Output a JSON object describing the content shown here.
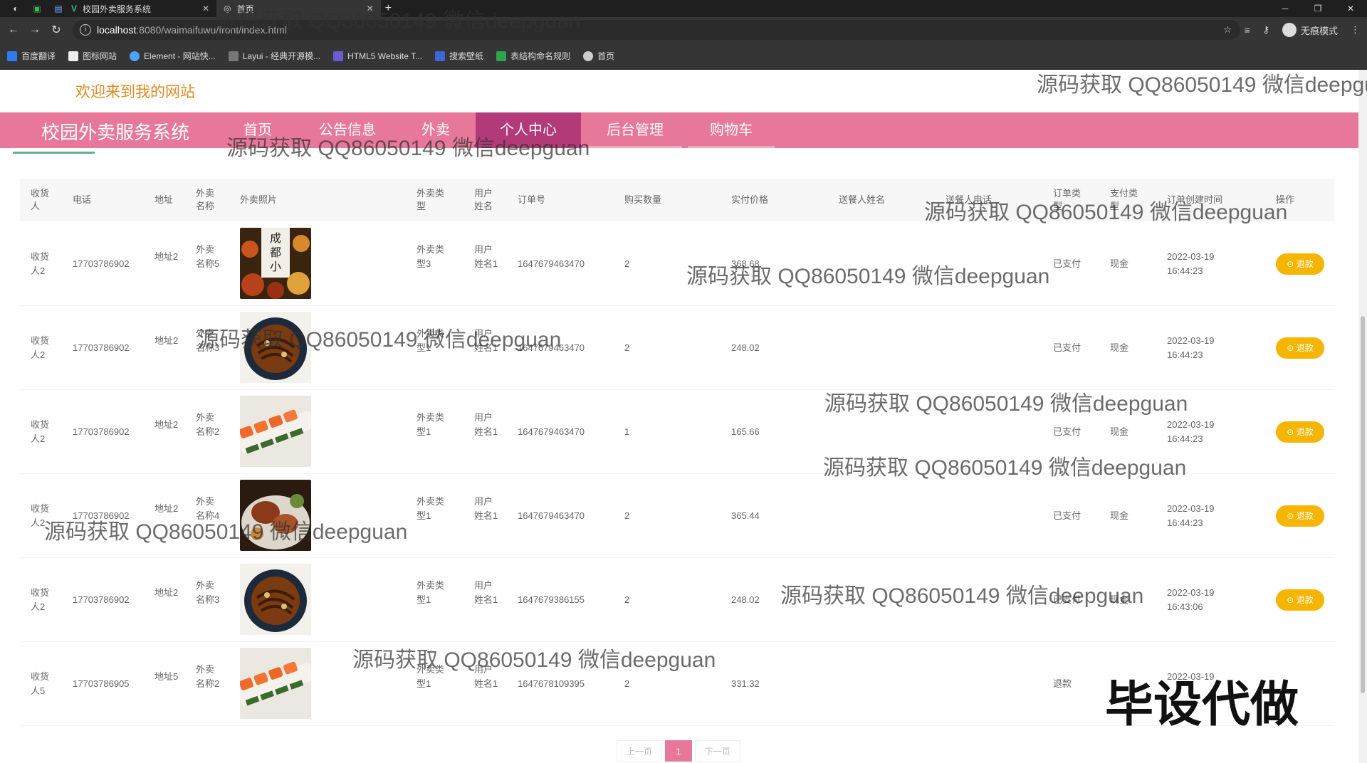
{
  "browser": {
    "tabs": [
      {
        "label": "校园外卖服务系统"
      },
      {
        "label": "首页"
      }
    ],
    "url_host": "localhost",
    "url_path": ":8080/waimaifuwu/front/index.html",
    "incognito_label": "无痕模式",
    "bookmarks": [
      "百度翻译",
      "图标网站",
      "Element - 网站快...",
      "Layui - 经典开源模...",
      "HTML5 Website T...",
      "搜索壁纸",
      "表结构命名规则",
      "首页"
    ]
  },
  "site": {
    "welcome": "欢迎来到我的网站",
    "brand": "校园外卖服务系统",
    "nav": [
      "首页",
      "公告信息",
      "外卖",
      "个人中心",
      "后台管理",
      "购物车"
    ],
    "active_nav": "个人中心"
  },
  "table": {
    "headers": [
      "收货人",
      "电话",
      "地址",
      "外卖名称",
      "外卖照片",
      "外卖类型",
      "用户姓名",
      "订单号",
      "购买数量",
      "实付价格",
      "送餐人姓名",
      "送餐人电话",
      "订单类型",
      "支付类型",
      "订单创建时间",
      "操作"
    ],
    "rows": [
      {
        "receiver": "收货人2",
        "phone": "17703786902",
        "address": "地址2",
        "name": "外卖名称5",
        "type": "外卖类型3",
        "user": "用户姓名1",
        "order_no": "1647679463470",
        "qty": "2",
        "price": "368.68",
        "status": "已支付",
        "pay": "现金",
        "date": "2022-03-19",
        "time": "16:44:23",
        "action": "退款",
        "photo": "chengdu-snack"
      },
      {
        "receiver": "收货人2",
        "phone": "17703786902",
        "address": "地址2",
        "name": "外卖名称3",
        "type": "外卖类型1",
        "user": "用户姓名1",
        "order_no": "1647679463470",
        "qty": "2",
        "price": "248.02",
        "status": "已支付",
        "pay": "现金",
        "date": "2022-03-19",
        "time": "16:44:23",
        "action": "退款",
        "photo": "noodle-bowl"
      },
      {
        "receiver": "收货人2",
        "phone": "17703786902",
        "address": "地址2",
        "name": "外卖名称2",
        "type": "外卖类型1",
        "user": "用户姓名1",
        "order_no": "1647679463470",
        "qty": "1",
        "price": "165.66",
        "status": "已支付",
        "pay": "现金",
        "date": "2022-03-19",
        "time": "16:44:23",
        "action": "退款",
        "photo": "sushi-roll"
      },
      {
        "receiver": "收货人2",
        "phone": "17703786902",
        "address": "地址2",
        "name": "外卖名称4",
        "type": "外卖类型1",
        "user": "用户姓名1",
        "order_no": "1647679463470",
        "qty": "2",
        "price": "365.44",
        "status": "已支付",
        "pay": "现金",
        "date": "2022-03-19",
        "time": "16:44:23",
        "action": "退款",
        "photo": "seafood-plate"
      },
      {
        "receiver": "收货人2",
        "phone": "17703786902",
        "address": "地址2",
        "name": "外卖名称3",
        "type": "外卖类型1",
        "user": "用户姓名1",
        "order_no": "1647679386155",
        "qty": "2",
        "price": "248.02",
        "status": "已支付",
        "pay": "现金",
        "date": "2022-03-19",
        "time": "16:43:06",
        "action": "退款",
        "photo": "noodle-bowl"
      },
      {
        "receiver": "收货人5",
        "phone": "17703786905",
        "address": "地址5",
        "name": "外卖名称2",
        "type": "外卖类型1",
        "user": "用户姓名1",
        "order_no": "1647678109395",
        "qty": "2",
        "price": "331.32",
        "status": "退款",
        "pay": "",
        "date": "2022-03-19",
        "time": "",
        "action": "",
        "photo": "sushi-roll"
      }
    ]
  },
  "pagination": {
    "prev": "上一页",
    "current": "1",
    "next": "下一页"
  },
  "watermark": "源码获取 QQ86050149 微信deepguan",
  "stamp": "毕设代做",
  "colors": {
    "nav_bg": "#e7789a",
    "nav_active": "#b23a78",
    "welcome": "#e08a22",
    "refund_btn": "#f5b500"
  }
}
